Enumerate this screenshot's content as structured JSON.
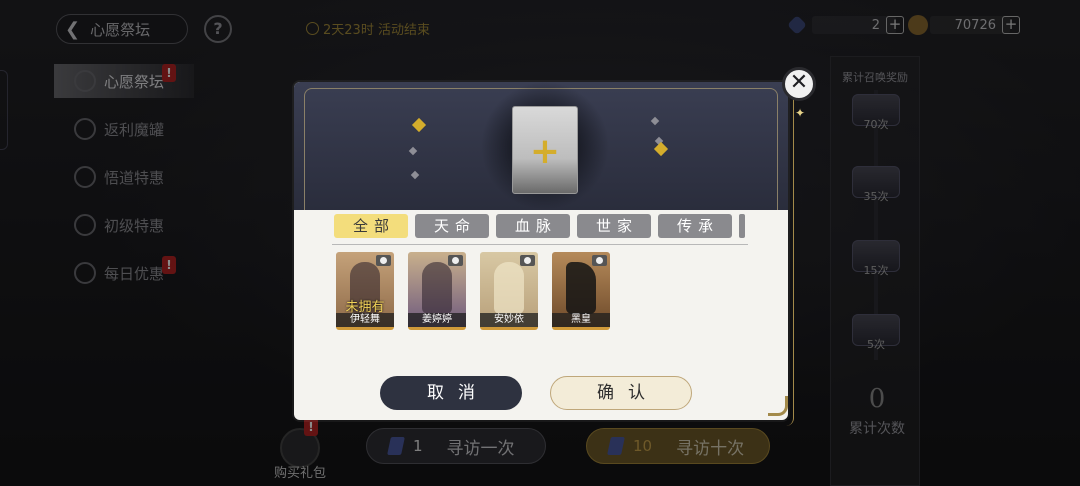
{
  "header": {
    "back_label": "心愿祭坛",
    "help_symbol": "?",
    "timer_text": "2天23时 活动结束"
  },
  "currencies": [
    {
      "icon": "ticket-icon",
      "value": "2"
    },
    {
      "icon": "coin-icon",
      "value": "70726"
    }
  ],
  "sidebar": {
    "items": [
      {
        "label": "心愿祭坛",
        "badge": "!"
      },
      {
        "label": "返利魔罐",
        "badge": ""
      },
      {
        "label": "悟道特惠",
        "badge": ""
      },
      {
        "label": "初级特惠",
        "badge": ""
      },
      {
        "label": "每日优惠",
        "badge": "!"
      }
    ]
  },
  "rewards": {
    "title": "累计召唤奖励",
    "items": [
      {
        "label": "70次"
      },
      {
        "label": "35次"
      },
      {
        "label": "15次"
      },
      {
        "label": "5次"
      }
    ],
    "count_value": "0",
    "count_label": "累计次数"
  },
  "bottom": {
    "gift_label": "购买礼包",
    "gift_badge": "!",
    "pull_one": {
      "count": "1",
      "label": "寻访一次"
    },
    "pull_ten": {
      "count": "10",
      "label": "寻访十次"
    }
  },
  "modal": {
    "slot_symbol": "+",
    "tabs": [
      {
        "label": "全部",
        "active": true
      },
      {
        "label": "天命",
        "active": false
      },
      {
        "label": "血脉",
        "active": false
      },
      {
        "label": "世家",
        "active": false
      },
      {
        "label": "传承",
        "active": false
      }
    ],
    "cards": [
      {
        "name": "伊轻舞",
        "status": "未拥有"
      },
      {
        "name": "姜婷婷",
        "status": ""
      },
      {
        "name": "安妙依",
        "status": ""
      },
      {
        "name": "黑皇",
        "status": ""
      }
    ],
    "cancel_label": "取消",
    "confirm_label": "确认",
    "close_symbol": "✕"
  },
  "colors": {
    "accent_gold": "#d4ad2c",
    "tab_active": "#f3dd7c",
    "badge_red": "#b42323"
  }
}
